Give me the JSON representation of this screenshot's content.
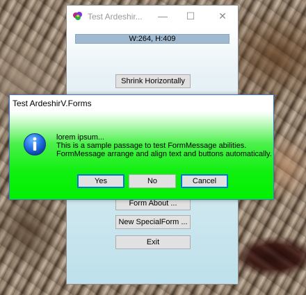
{
  "main_window": {
    "title": "Test Ardeshir...",
    "size_label": "W:264, H:409",
    "buttons": {
      "shrink": "Shrink Horizontally",
      "about": "Form About ...",
      "special": "New SpecialForm ...",
      "exit": "Exit"
    },
    "controls": {
      "minimize": "—",
      "maximize": "☐",
      "close": "✕"
    }
  },
  "dialog": {
    "title": "Test ArdeshirV.Forms",
    "message_lines": [
      "lorem ipsum...",
      "This is a sample passage to test FormMessage abilities.",
      "FormMessage arrange and align text and buttons automatically."
    ],
    "buttons": {
      "yes": "Yes",
      "no": "No",
      "cancel": "Cancel"
    },
    "icon": "information-icon"
  },
  "colors": {
    "dialog_gradient_end": "#00f000",
    "focus_border": "#0078d7",
    "size_label_bg": "#9fbad0",
    "main_window_bottom": "#bde0eb"
  }
}
